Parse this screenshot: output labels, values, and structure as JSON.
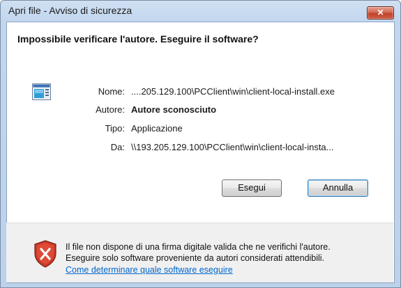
{
  "window": {
    "title": "Apri file - Avviso di sicurezza",
    "close_glyph": "✕"
  },
  "heading": "Impossibile verificare l'autore. Eseguire il software?",
  "file_icon": "application-window-icon",
  "details": {
    "name_label": "Nome:",
    "name_value": "....205.129.100\\PCClient\\win\\client-local-install.exe",
    "author_label": "Autore:",
    "author_value": "Autore sconosciuto",
    "type_label": "Tipo:",
    "type_value": "Applicazione",
    "from_label": "Da:",
    "from_value": "\\\\193.205.129.100\\PCClient\\win\\client-local-insta..."
  },
  "buttons": {
    "run_label": "Esegui",
    "cancel_label": "Annulla"
  },
  "footer": {
    "shield_icon": "security-shield-error-icon",
    "line1": "Il file non dispone di una firma digitale valida che ne verifichi l'autore.",
    "line2": "Eseguire solo software proveniente da autori considerati attendibili.",
    "link_text": "Come determinare quale software eseguire"
  },
  "colors": {
    "link": "#0066cc",
    "close_button": "#c2432c"
  }
}
